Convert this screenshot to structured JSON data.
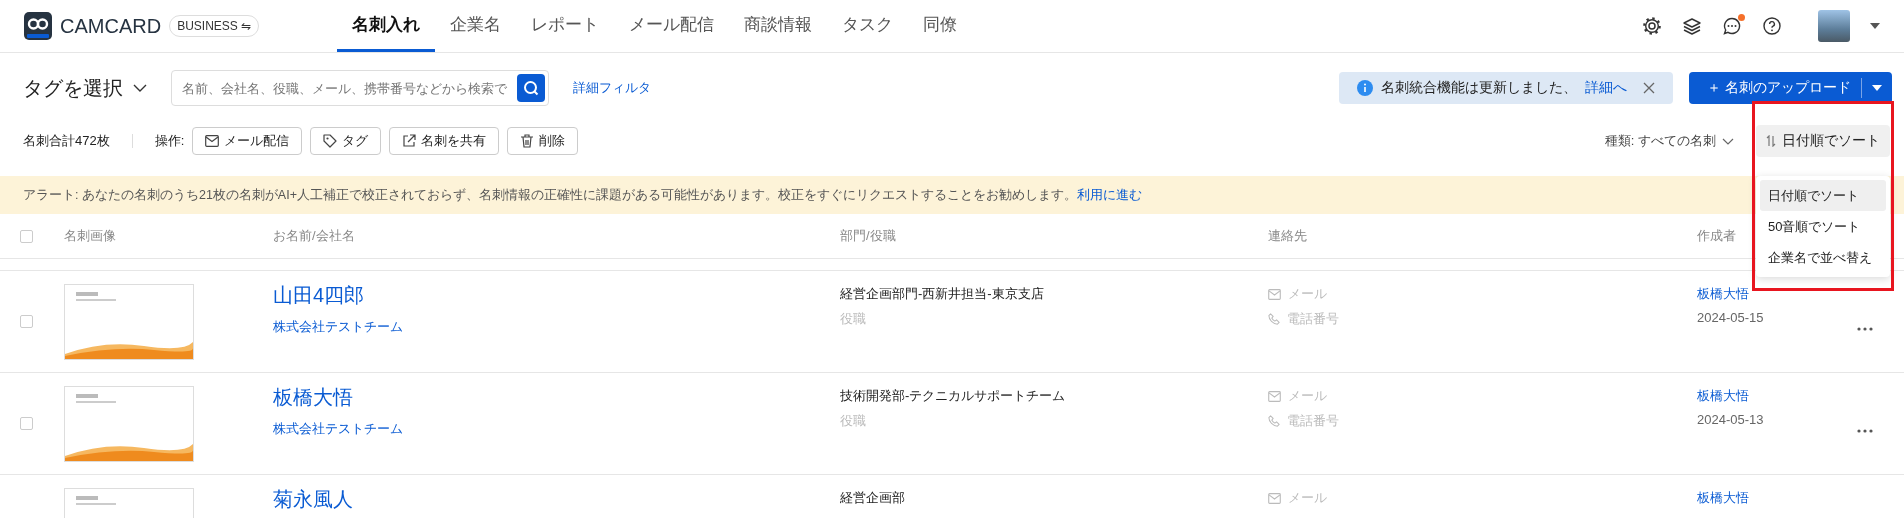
{
  "brand": {
    "name": "CAMCARD",
    "edition": "BUSINESS ⇋"
  },
  "nav_tabs": [
    {
      "label": "名刺入れ",
      "selected": true
    },
    {
      "label": "企業名",
      "selected": false
    },
    {
      "label": "レポート",
      "selected": false
    },
    {
      "label": "メール配信",
      "selected": false
    },
    {
      "label": "商談情報",
      "selected": false
    },
    {
      "label": "タスク",
      "selected": false
    },
    {
      "label": "同僚",
      "selected": false
    }
  ],
  "header_icons": [
    {
      "kind": "settings"
    },
    {
      "kind": "layers"
    },
    {
      "kind": "chat",
      "badge": true
    },
    {
      "kind": "help"
    }
  ],
  "tag_select": "タグを選択",
  "search": {
    "placeholder": "名前、会社名、役職、メール、携帯番号などから検索で"
  },
  "advanced_filter": "詳細フィルタ",
  "notice": {
    "text": "名刺統合機能は更新しました、",
    "link": "詳細へ"
  },
  "upload_button": "＋ 名刺のアップロード",
  "total": "名刺合計472枚",
  "actions_label": "操作:",
  "actions": [
    {
      "kind": "mail",
      "label": "メール配信"
    },
    {
      "kind": "tag",
      "label": "タグ"
    },
    {
      "kind": "share",
      "label": "名刺を共有"
    },
    {
      "kind": "delete",
      "label": "削除"
    }
  ],
  "type_filter": "種類: すべての名刺",
  "sort_button": "日付順でソート",
  "sort_menu": [
    {
      "label": "日付順でソート",
      "selected": true
    },
    {
      "label": "50音順でソート",
      "selected": false
    },
    {
      "label": "企業名で並べ替え",
      "selected": false
    }
  ],
  "alert": {
    "text": "アラート: あなたの名刺のうち21枚の名刺がAI+人工補正で校正されておらず、名刺情報の正確性に課題がある可能性があります。校正をすぐにリクエストすることをお勧めします。",
    "link": "利用に進む"
  },
  "table": {
    "select_all": {
      "checked": false
    },
    "columns": [
      "名刺画像",
      "お名前/会社名",
      "部門/役職",
      "連絡先",
      "作成者"
    ],
    "rows": [
      {
        "checked": false,
        "name": "山田4四郎",
        "company": "株式会社テストチーム",
        "department": "経営企画部門-西新井担当-東京支店",
        "title": "役職",
        "email": "メール",
        "phone": "電話番号",
        "creator": "板橋大悟",
        "date": "2024-05-15"
      },
      {
        "checked": false,
        "name": "板橋大悟",
        "company": "株式会社テストチーム",
        "department": "技術開発部-テクニカルサポートチーム",
        "title": "役職",
        "email": "メール",
        "phone": "電話番号",
        "creator": "板橋大悟",
        "date": "2024-05-13"
      },
      {
        "name": "菊永風人",
        "department": "経営企画部",
        "email": "メール",
        "creator": "板橋大悟"
      }
    ]
  }
}
